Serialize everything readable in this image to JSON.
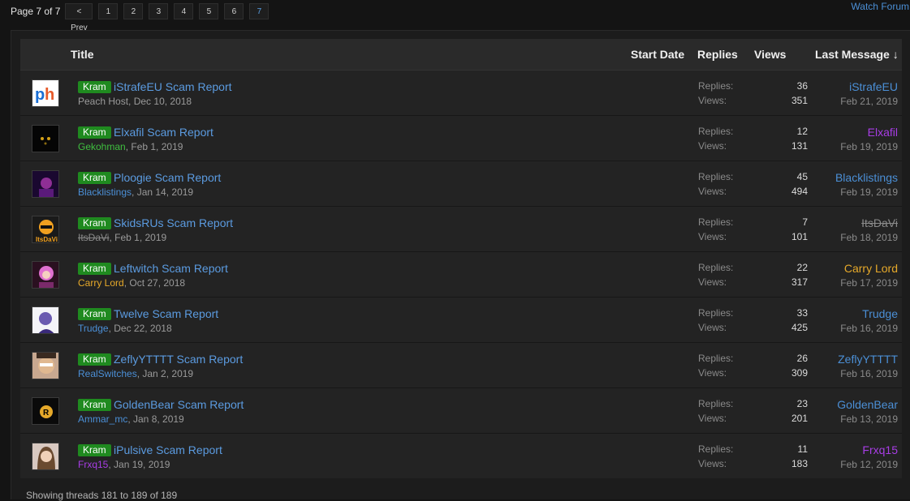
{
  "pagination": {
    "label": "Page 7 of 7",
    "prev": "< Prev",
    "pages": [
      "1",
      "2",
      "3",
      "4",
      "5",
      "6",
      "7"
    ],
    "current": "7"
  },
  "watch_forum": "Watch Forum",
  "columns": {
    "title": "Title",
    "start_date": "Start Date",
    "replies": "Replies",
    "views": "Views",
    "last_message": "Last Message ↓"
  },
  "stat_labels": {
    "replies": "Replies:",
    "views": "Views:"
  },
  "threads": [
    {
      "prefix": "Kram",
      "title": "iStrafeEU Scam Report",
      "author": "Peach Host",
      "author_color": "#9a9a9a",
      "start": ", Dec 10, 2018",
      "replies": "36",
      "views": "351",
      "last_user": "iStrafeEU",
      "last_color": "#4b8fd6",
      "last_date": "Feb 21, 2019",
      "avatar": "ph-logo"
    },
    {
      "prefix": "Kram",
      "title": "Elxafil Scam Report",
      "author": "Gekohman",
      "author_color": "#3fbf3f",
      "start": ", Feb 1, 2019",
      "replies": "12",
      "views": "131",
      "last_user": "Elxafil",
      "last_color": "#a83de6",
      "last_date": "Feb 19, 2019",
      "avatar": "dark-avatar"
    },
    {
      "prefix": "Kram",
      "title": "Ploogie Scam Report",
      "author": "Blacklistings",
      "author_color": "#4b8fd6",
      "start": ", Jan 14, 2019",
      "replies": "45",
      "views": "494",
      "last_user": "Blacklistings",
      "last_color": "#4b8fd6",
      "last_date": "Feb 19, 2019",
      "avatar": "purple-avatar"
    },
    {
      "prefix": "Kram",
      "title": "SkidsRUs Scam Report",
      "author": "ItsDaVi",
      "author_color": "strike",
      "start": ", Feb 1, 2019",
      "replies": "7",
      "views": "101",
      "last_user": "ItsDaVi",
      "last_color": "strike",
      "last_date": "Feb 18, 2019",
      "avatar": "itsdavi-avatar"
    },
    {
      "prefix": "Kram",
      "title": "Leftwitch Scam Report",
      "author": "Carry Lord",
      "author_color": "#e6a92a",
      "start": ", Oct 27, 2018",
      "replies": "22",
      "views": "317",
      "last_user": "Carry Lord",
      "last_color": "#e6a92a",
      "last_date": "Feb 17, 2019",
      "avatar": "pink-avatar"
    },
    {
      "prefix": "Kram",
      "title": "Twelve Scam Report",
      "author": "Trudge",
      "author_color": "#4b8fd6",
      "start": ", Dec 22, 2018",
      "replies": "33",
      "views": "425",
      "last_user": "Trudge",
      "last_color": "#4b8fd6",
      "last_date": "Feb 16, 2019",
      "avatar": "white-avatar"
    },
    {
      "prefix": "Kram",
      "title": "ZeflyYTTTT Scam Report",
      "author": "RealSwitches",
      "author_color": "#4b8fd6",
      "start": ", Jan 2, 2019",
      "replies": "26",
      "views": "309",
      "last_user": "ZeflyYTTTT",
      "last_color": "#4b8fd6",
      "last_date": "Feb 16, 2019",
      "avatar": "face-avatar"
    },
    {
      "prefix": "Kram",
      "title": "GoldenBear Scam Report",
      "author": "Ammar_mc",
      "author_color": "#4b8fd6",
      "start": ", Jan 8, 2019",
      "replies": "23",
      "views": "201",
      "last_user": "GoldenBear",
      "last_color": "#4b8fd6",
      "last_date": "Feb 13, 2019",
      "avatar": "bear-avatar"
    },
    {
      "prefix": "Kram",
      "title": "iPulsive Scam Report",
      "author": "Frxq15",
      "author_color": "#a83de6",
      "start": ", Jan 19, 2019",
      "replies": "11",
      "views": "183",
      "last_user": "Frxq15",
      "last_color": "#a83de6",
      "last_date": "Feb 12, 2019",
      "avatar": "girl-avatar"
    }
  ],
  "footer": "Showing threads 181 to 189 of 189"
}
